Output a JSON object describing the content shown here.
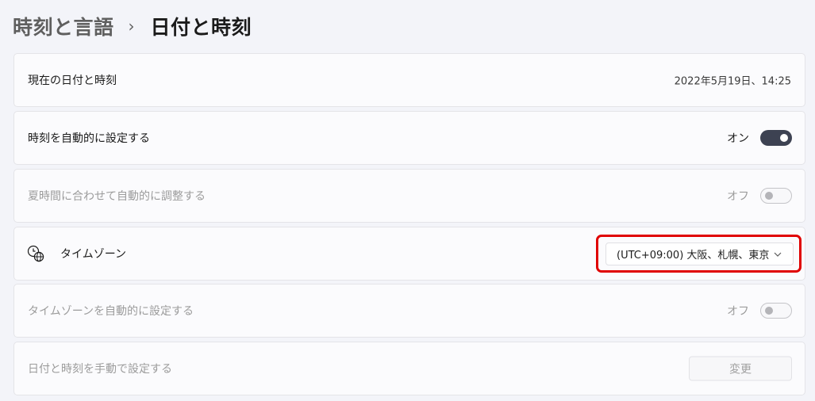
{
  "breadcrumb": {
    "parent": "時刻と言語",
    "separator": "›",
    "current": "日付と時刻"
  },
  "settings": {
    "current_datetime": {
      "label": "現在の日付と時刻",
      "value": "2022年5月19日、14:25"
    },
    "auto_time": {
      "label": "時刻を自動的に設定する",
      "state_label": "オン",
      "on": true
    },
    "dst": {
      "label": "夏時間に合わせて自動的に調整する",
      "state_label": "オフ",
      "on": false,
      "disabled": true
    },
    "timezone": {
      "label": "タイムゾーン",
      "icon": "clock-globe-icon",
      "selected": "(UTC+09:00) 大阪、札幌、東京"
    },
    "auto_timezone": {
      "label": "タイムゾーンを自動的に設定する",
      "state_label": "オフ",
      "on": false,
      "disabled": true
    },
    "manual_set": {
      "label": "日付と時刻を手動で設定する",
      "button_label": "変更",
      "disabled": true
    }
  },
  "colors": {
    "background": "#f3f4f9",
    "card": "#fbfbfd",
    "toggle_on": "#3d4252",
    "highlight": "#e00000"
  }
}
